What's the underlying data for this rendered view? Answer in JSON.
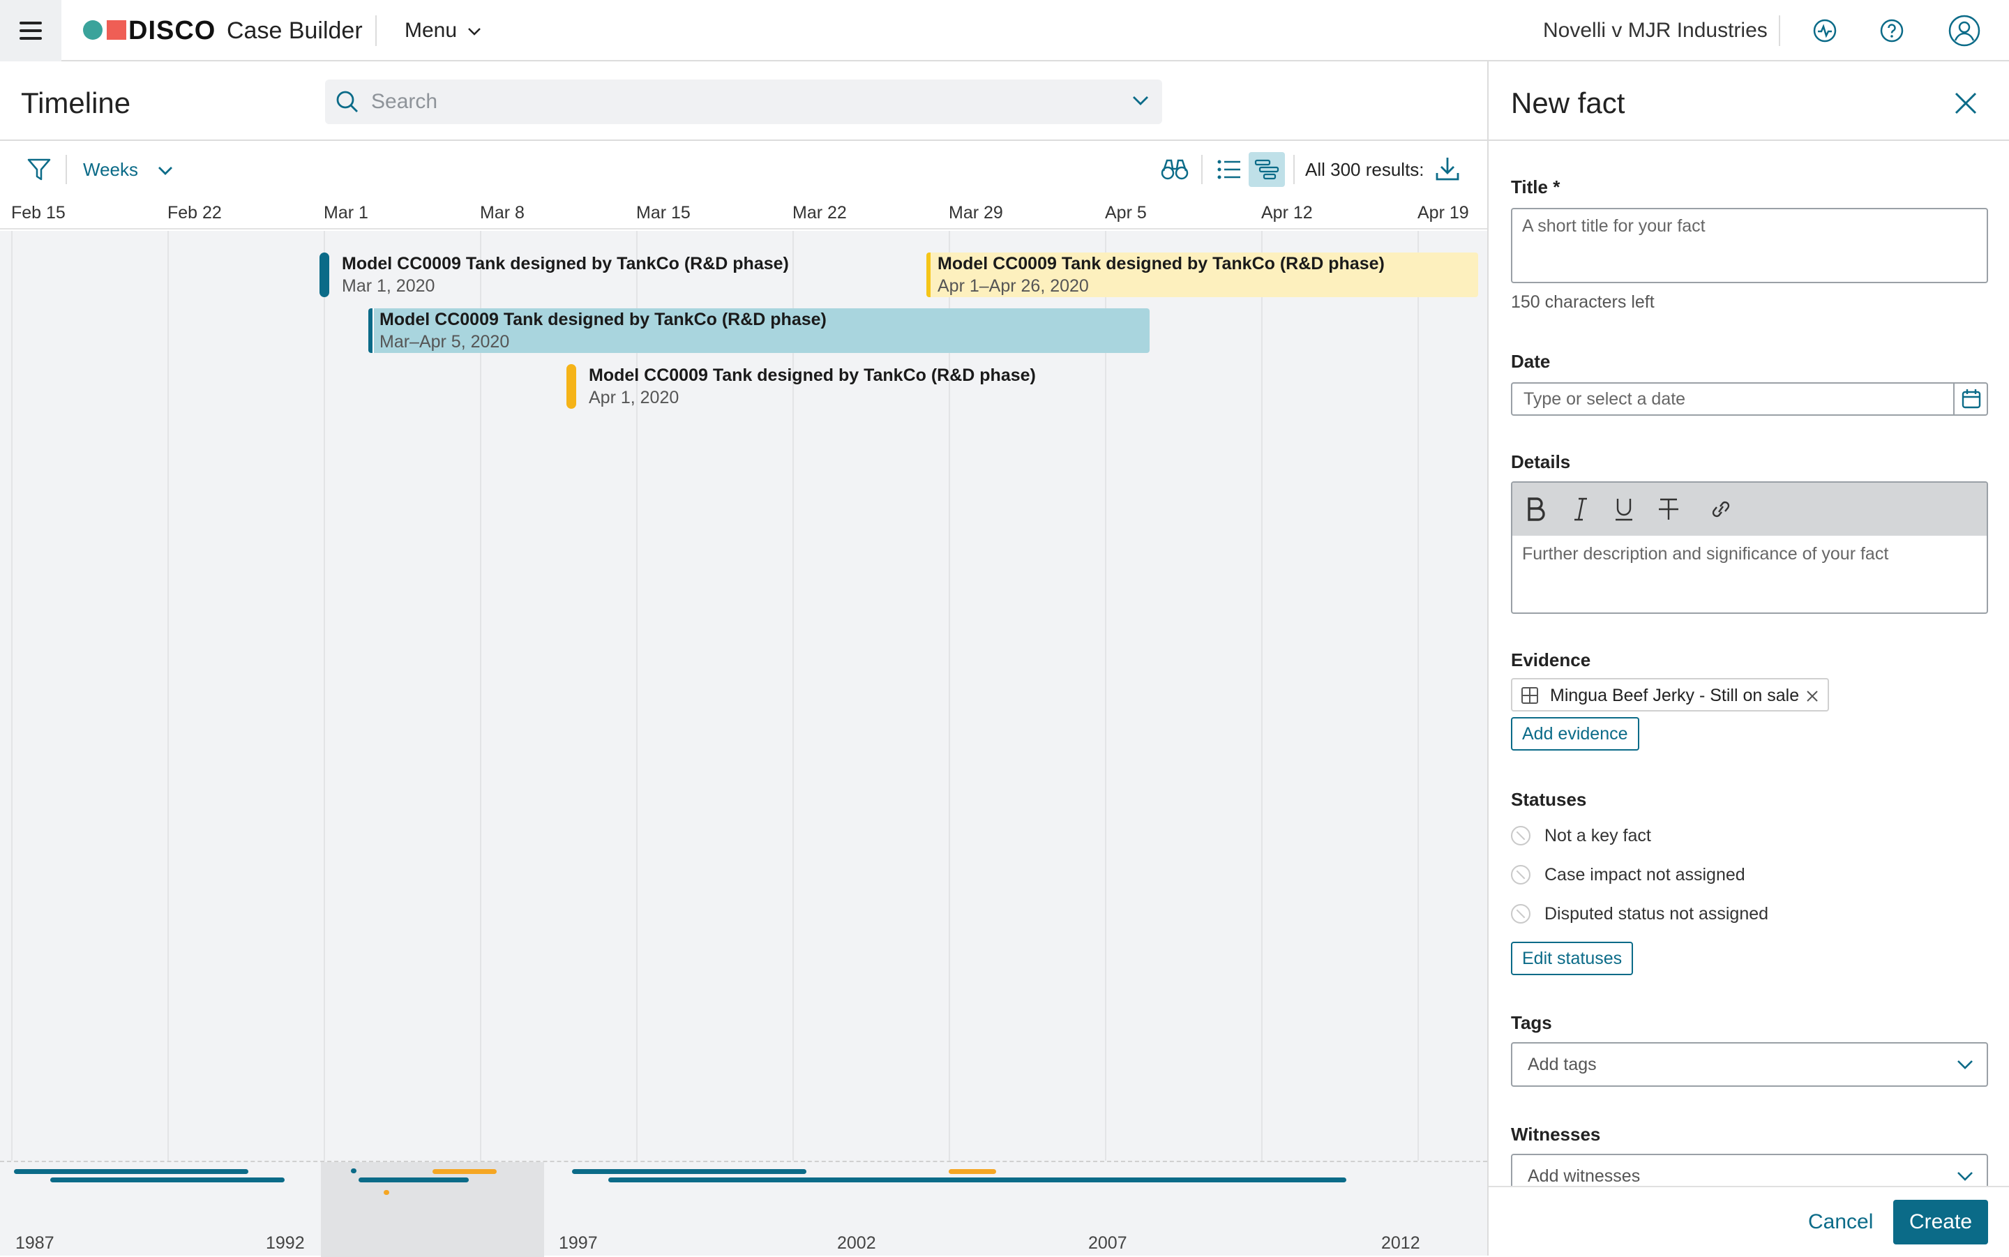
{
  "header": {
    "logo_text": "DISCO",
    "app_name": "Case Builder",
    "menu_label": "Menu",
    "case_name": "Novelli v MJR Industries"
  },
  "timeline": {
    "title": "Timeline",
    "search_placeholder": "Search",
    "zoom_label": "Weeks",
    "results_label": "All 300 results:",
    "axis_labels": [
      "Feb 15",
      "Feb 22",
      "Mar 1",
      "Mar 8",
      "Mar 15",
      "Mar 22",
      "Mar 29",
      "Apr 5",
      "Apr 12",
      "Apr 19"
    ],
    "events": [
      {
        "title": "Model CC0009 Tank designed by TankCo (R&D phase)",
        "date": "Mar 1, 2020",
        "color": "#0b6b88",
        "style": "point"
      },
      {
        "title": "Model CC0009 Tank designed by TankCo (R&D phase)",
        "date": "Apr 1–Apr 26, 2020",
        "color": "#f5c518",
        "style": "range"
      },
      {
        "title": "Model CC0009 Tank designed by TankCo (R&D phase)",
        "date": "Mar–Apr 5, 2020",
        "color": "#0b6b88",
        "style": "range"
      },
      {
        "title": "Model CC0009 Tank designed by TankCo (R&D phase)",
        "date": "Apr 1, 2020",
        "color": "#f5b318",
        "style": "point"
      }
    ],
    "overview_years": [
      "1987",
      "1992",
      "1997",
      "2002",
      "2007",
      "2012"
    ]
  },
  "panel": {
    "title": "New fact",
    "title_label": "Title *",
    "title_placeholder": "A short title for your fact",
    "chars_left": "150 characters left",
    "date_label": "Date",
    "date_placeholder": "Type or select a date",
    "details_label": "Details",
    "details_placeholder": "Further description and significance of your fact",
    "evidence_label": "Evidence",
    "evidence_chip": "Mingua Beef Jerky - Still on sale",
    "add_evidence": "Add evidence",
    "statuses_label": "Statuses",
    "statuses": [
      "Not a key fact",
      "Case impact not assigned",
      "Disputed status not assigned"
    ],
    "edit_statuses": "Edit statuses",
    "tags_label": "Tags",
    "tags_placeholder": "Add tags",
    "witnesses_label": "Witnesses",
    "witnesses_placeholder": "Add witnesses",
    "cancel": "Cancel",
    "create": "Create"
  },
  "colors": {
    "accent": "#0b6b88",
    "highlight_yellow": "#fdf0be",
    "range_blue": "#a9d5de",
    "overview_orange": "#f5a623"
  }
}
